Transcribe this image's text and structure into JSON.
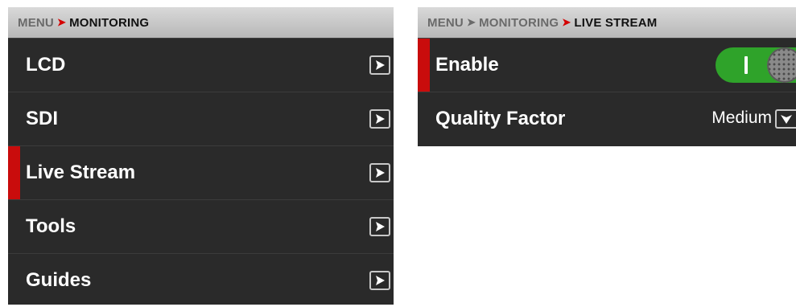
{
  "monitoring_menu": {
    "breadcrumb": {
      "root": "MENU",
      "current": "MONITORING"
    },
    "items": [
      {
        "label": "LCD",
        "selected": false
      },
      {
        "label": "SDI",
        "selected": false
      },
      {
        "label": "Live Stream",
        "selected": true
      },
      {
        "label": "Tools",
        "selected": false
      },
      {
        "label": "Guides",
        "selected": false
      }
    ]
  },
  "live_stream_menu": {
    "breadcrumb": {
      "root": "MENU",
      "middle": "MONITORING",
      "current": "LIVE STREAM"
    },
    "enable": {
      "label": "Enable",
      "value": true,
      "selected": true
    },
    "quality_factor": {
      "label": "Quality Factor",
      "value": "Medium"
    }
  },
  "colors": {
    "accent_red": "#c90c0c",
    "toggle_green": "#2fa32a",
    "panel_bg": "#2a2a2a"
  },
  "icons": {
    "row_arrow": "chevron-right-icon",
    "dropdown": "chevron-down-icon"
  }
}
